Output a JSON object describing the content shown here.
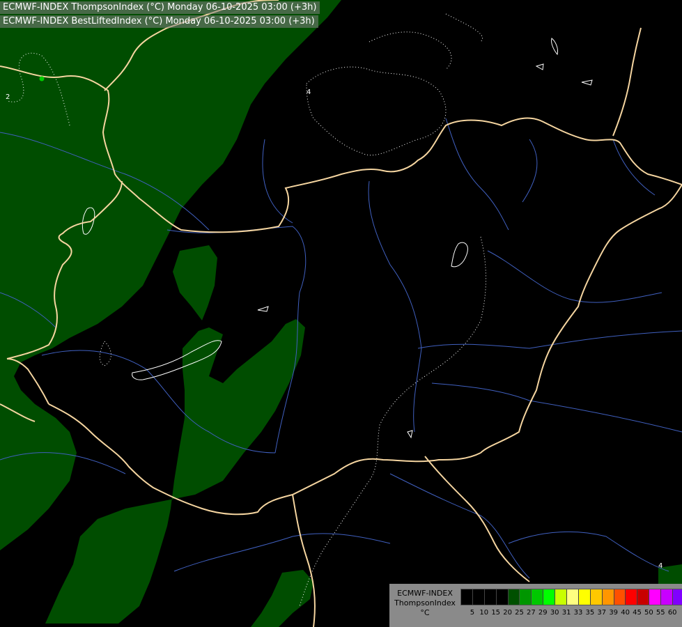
{
  "titles": {
    "line1": "ECMWF-INDEX ThompsonIndex (°C) Monday 06-10-2025 03:00 (+3h)",
    "line2": "ECMWF-INDEX BestLiftedIndex (°C) Monday 06-10-2025 03:00 (+3h)"
  },
  "contour_labels": [
    "2",
    "4",
    "4"
  ],
  "legend": {
    "model": "ECMWF-INDEX",
    "parameter": "ThompsonIndex",
    "unit": "°C",
    "colors": [
      "#000000",
      "#000000",
      "#000000",
      "#000000",
      "#005000",
      "#009600",
      "#00c800",
      "#00ff00",
      "#c8ff00",
      "#ffff80",
      "#ffff00",
      "#ffc800",
      "#ff9600",
      "#ff5000",
      "#ff0000",
      "#c80000",
      "#ff00ff",
      "#c800ff",
      "#8000ff",
      "#5000ff",
      "#0000ff"
    ],
    "ticks": [
      "5",
      "10",
      "15",
      "20",
      "25",
      "27",
      "29",
      "30",
      "31",
      "33",
      "35",
      "37",
      "39",
      "40",
      "45",
      "50",
      "55",
      "60"
    ]
  },
  "colors": {
    "background": "#000000",
    "field_green": "#004d00",
    "borders": "#f5d5a0",
    "rivers": "#4060c0",
    "contours": "#ffffff"
  }
}
